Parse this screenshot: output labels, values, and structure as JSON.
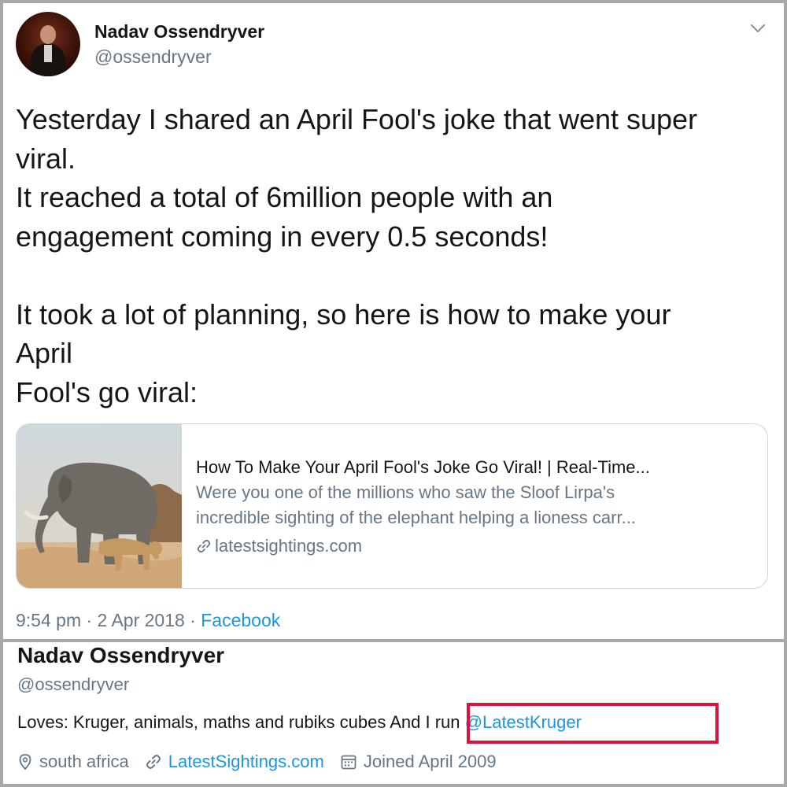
{
  "tweet": {
    "author": {
      "name": "Nadav Ossendryver",
      "handle": "@ossendryver"
    },
    "text_lines": [
      "Yesterday I shared an April Fool's joke that went super",
      "viral.",
      "It reached a total of 6million people with an",
      "engagement coming in every 0.5 seconds!",
      "",
      "It took a lot of planning, so here is how to make your",
      "April",
      "Fool's go viral:"
    ],
    "card": {
      "image_icon": "elephant-lioness-photo",
      "title": "How To Make Your April Fool's Joke Go Viral! | Real-Time...",
      "description_lines": [
        "Were you one of the millions who saw the Sloof Lirpa's",
        "incredible sighting of the elephant helping a lioness carr..."
      ],
      "link_icon": "link-icon",
      "domain": "latestsightings.com"
    },
    "timestamp": "9:54 pm · 2 Apr 2018 · ",
    "source": "Facebook"
  },
  "profile": {
    "name": "Nadav Ossendryver",
    "handle": "@ossendryver",
    "bio_text": "Loves: Kruger, animals, maths and rubiks cubes ",
    "bio_highlight_text": "And I run ",
    "bio_mention": "@LatestKruger",
    "location_icon": "location-pin-icon",
    "location": "south africa",
    "url_icon": "link-icon",
    "url": "LatestSightings.com",
    "joined_icon": "calendar-icon",
    "joined": "Joined April 2009"
  },
  "colors": {
    "link_blue": "#1b95e0",
    "secondary_text": "#657786",
    "highlight_red": "#e0123d"
  }
}
